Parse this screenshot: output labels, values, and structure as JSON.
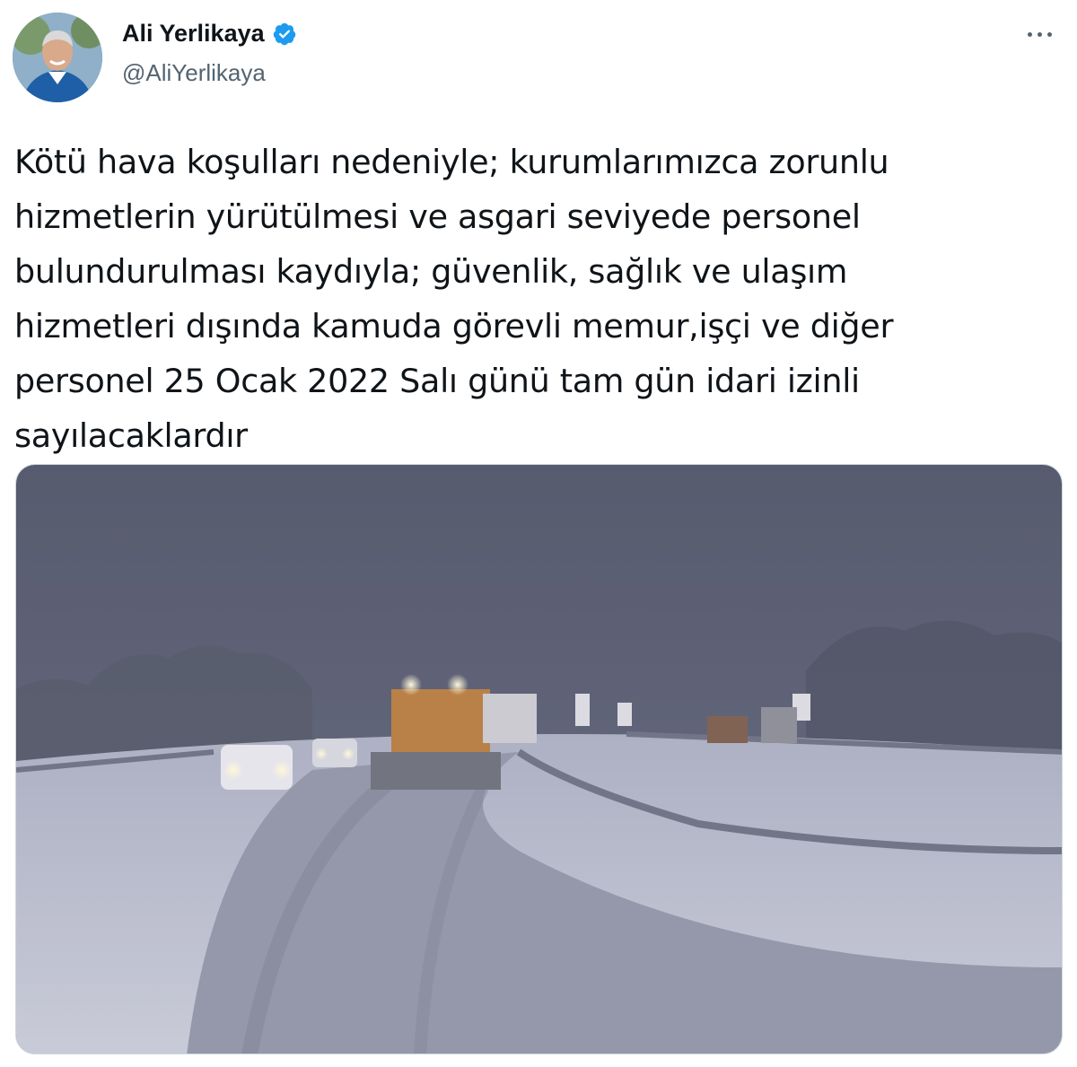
{
  "author": {
    "name": "Ali Yerlikaya",
    "handle": "@AliYerlikaya",
    "verified": true,
    "verified_icon": "verified-badge-icon",
    "avatar_icon": "profile-avatar"
  },
  "menu": {
    "icon": "more-dots-icon"
  },
  "tweet": {
    "lines": [
      "Kötü hava koşulları nedeniyle; kurumlarımızca zorunlu",
      "hizmetlerin yürütülmesi ve asgari seviyede personel",
      "bulundurulması kaydıyla; güvenlik, sağlık ve ulaşım",
      "hizmetleri dışında kamuda görevli memur,işçi ve diğer",
      "personel 25 Ocak 2022 Salı günü tam gün idari izinli",
      "sayılacaklardır"
    ]
  },
  "media": {
    "kind": "photo",
    "subject": "snowplow-on-snowy-road"
  },
  "colors": {
    "accent_blue": "#1d9bf0",
    "text": "#0f1419",
    "secondary_text": "#536471"
  }
}
